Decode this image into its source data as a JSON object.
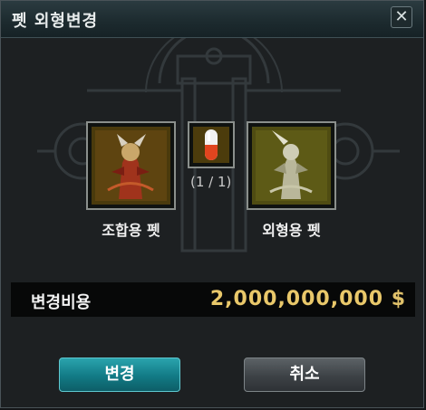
{
  "window": {
    "title": "펫 외형변경",
    "close_glyph": "✕"
  },
  "slots": {
    "combine_pet": {
      "label": "조합용 펫",
      "icon": "pet-portrait-red"
    },
    "capsule": {
      "count_text": "(1 / 1)",
      "icon": "pill-capsule"
    },
    "appearance_pet": {
      "label": "외형용 펫",
      "icon": "pet-portrait-yellow"
    }
  },
  "cost": {
    "label": "변경비용",
    "value": "2,000,000,000",
    "currency": "$"
  },
  "buttons": {
    "confirm_label": "변경",
    "cancel_label": "취소"
  },
  "colors": {
    "accent": "#1a8f99",
    "gold": "#e9c86a",
    "slot_border": "#8a8f8c"
  }
}
